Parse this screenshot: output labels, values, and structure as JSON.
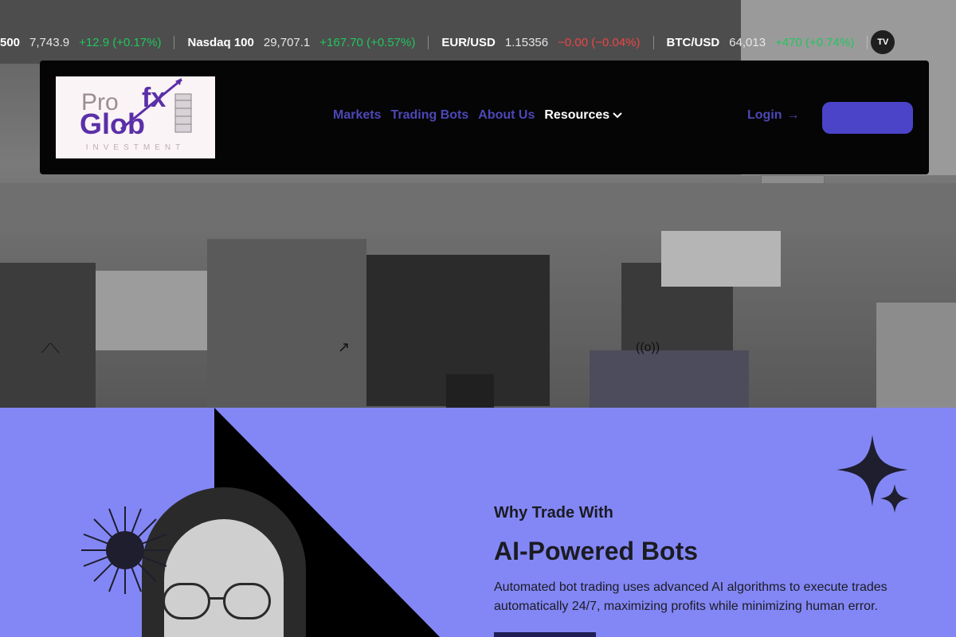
{
  "ticker": [
    {
      "symbol": "500",
      "price": "7,743.9",
      "change": "+12.9 (+0.17%)",
      "direction": "up"
    },
    {
      "symbol": "Nasdaq 100",
      "price": "29,707.1",
      "change": "+167.70 (+0.57%)",
      "direction": "up"
    },
    {
      "symbol": "EUR/USD",
      "price": "1.15356",
      "change": "−0.00 (−0.04%)",
      "direction": "down"
    },
    {
      "symbol": "BTC/USD",
      "price": "64,013",
      "change": "+470 (+0.74%)",
      "direction": "up"
    }
  ],
  "ticker_badge": "TV",
  "logo": {
    "line1a": "Pro",
    "line1b": "fx",
    "line2": "Glob",
    "tagline": "INVESTMENT"
  },
  "nav": {
    "links": [
      {
        "label": "Markets"
      },
      {
        "label": "Trading Bots"
      },
      {
        "label": "About Us"
      }
    ],
    "dropdown_label": "Resources",
    "login_label": "Login",
    "login_arrow": "→",
    "chevron": "⌄"
  },
  "section": {
    "eyebrow": "Why Trade With",
    "headline": "AI-Powered Bots",
    "description": "Automated bot trading uses advanced AI algorithms to execute trades automatically 24/7, maximizing profits while minimizing human error."
  },
  "colors": {
    "accent": "#4b44c9",
    "nav_link": "#4d47b8",
    "section_bg": "#8387f5",
    "up": "#22c55e",
    "down": "#ef4444"
  }
}
